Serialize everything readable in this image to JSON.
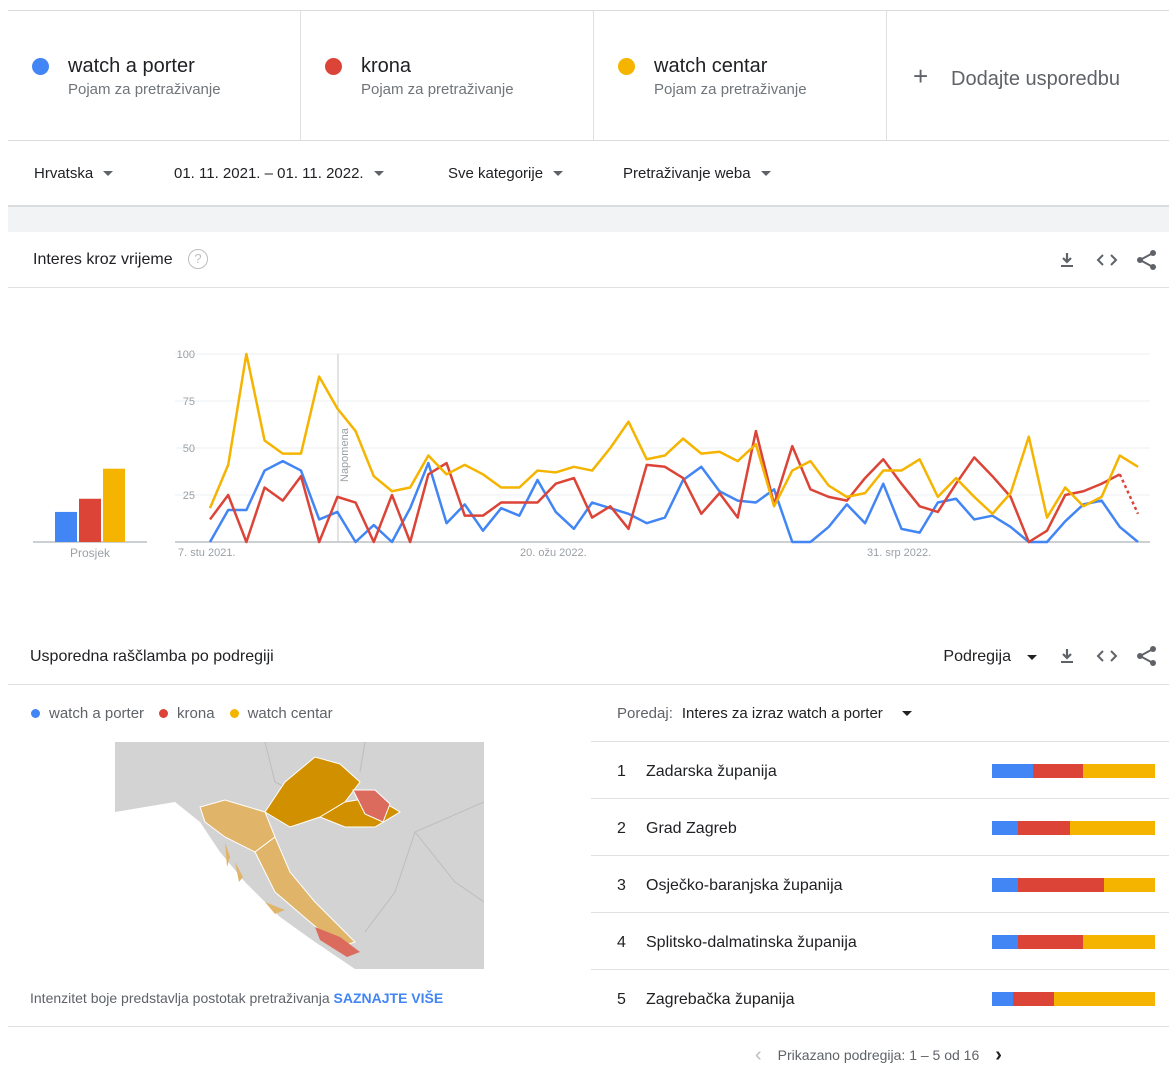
{
  "terms": [
    {
      "name": "watch a porter",
      "sub": "Pojam za pretraživanje",
      "color": "#4285f4"
    },
    {
      "name": "krona",
      "sub": "Pojam za pretraživanje",
      "color": "#db4437"
    },
    {
      "name": "watch centar",
      "sub": "Pojam za pretraživanje",
      "color": "#f4b400"
    }
  ],
  "add_compare": "Dodajte usporedbu",
  "filters": {
    "region": "Hrvatska",
    "date_range": "01. 11. 2021. – 01. 11. 2022.",
    "category": "Sve kategorije",
    "search_type": "Pretraživanje weba"
  },
  "interest": {
    "title": "Interes kroz vrijeme",
    "help": "?",
    "average_label": "Prosjek",
    "note_label": "Napomena"
  },
  "chart_data": {
    "type": "line",
    "x_ticks": [
      "7. stu 2021.",
      "20. ožu 2022.",
      "31. srp 2022."
    ],
    "y_ticks": [
      25,
      50,
      75,
      100
    ],
    "ylim": [
      0,
      100
    ],
    "grid": true,
    "averages": [
      {
        "name": "watch a porter",
        "value": 16
      },
      {
        "name": "krona",
        "value": 23
      },
      {
        "name": "watch centar",
        "value": 39
      }
    ],
    "series": [
      {
        "name": "watch a porter",
        "color": "#4285f4",
        "values": [
          0,
          17,
          17,
          38,
          43,
          38,
          12,
          16,
          0,
          9,
          0,
          18,
          42,
          10,
          20,
          6,
          18,
          14,
          33,
          16,
          7,
          21,
          18,
          15,
          10,
          13,
          33,
          40,
          27,
          22,
          21,
          28,
          0,
          0,
          8,
          20,
          10,
          31,
          7,
          5,
          21,
          23,
          12,
          14,
          8,
          0,
          0,
          11,
          20,
          22,
          8,
          0
        ]
      },
      {
        "name": "krona",
        "color": "#db4437",
        "values": [
          12,
          25,
          0,
          29,
          22,
          35,
          0,
          24,
          21,
          0,
          25,
          0,
          36,
          42,
          14,
          14,
          21,
          21,
          21,
          31,
          34,
          13,
          19,
          7,
          41,
          40,
          34,
          15,
          26,
          13,
          59,
          20,
          51,
          28,
          24,
          22,
          34,
          44,
          31,
          19,
          16,
          31,
          45,
          35,
          24,
          0,
          6,
          25,
          27,
          31,
          36,
          15
        ],
        "dotted_tail_from": 50
      },
      {
        "name": "watch centar",
        "color": "#f4b400",
        "values": [
          18,
          41,
          100,
          54,
          47,
          47,
          88,
          71,
          59,
          35,
          27,
          29,
          46,
          36,
          41,
          36,
          29,
          29,
          38,
          37,
          40,
          38,
          50,
          64,
          44,
          46,
          55,
          47,
          48,
          43,
          52,
          19,
          38,
          43,
          30,
          24,
          26,
          38,
          38,
          44,
          24,
          34,
          24,
          15,
          26,
          56,
          13,
          29,
          19,
          24,
          46,
          40
        ]
      }
    ]
  },
  "subregion": {
    "title": "Usporedna raščlamba po podregiji",
    "selector": "Podregija",
    "sort_key": "Poredaj:",
    "sort_value": "Interes za izraz watch a porter",
    "map_note": "Intenzitet boje predstavlja postotak pretraživanja",
    "map_link": "SAZNAJTE VIŠE",
    "rows": [
      {
        "rank": "1",
        "name": "Zadarska županija",
        "shares": [
          25,
          31,
          44
        ]
      },
      {
        "rank": "2",
        "name": "Grad Zagreb",
        "shares": [
          16,
          32,
          52
        ]
      },
      {
        "rank": "3",
        "name": "Osječko-baranjska županija",
        "shares": [
          16,
          53,
          31
        ]
      },
      {
        "rank": "4",
        "name": "Splitsko-dalmatinska županija",
        "shares": [
          16,
          40,
          44
        ]
      },
      {
        "rank": "5",
        "name": "Zagrebačka županija",
        "shares": [
          13,
          25,
          62
        ]
      }
    ],
    "pager": "Prikazano podregija: 1 – 5 od 16"
  }
}
